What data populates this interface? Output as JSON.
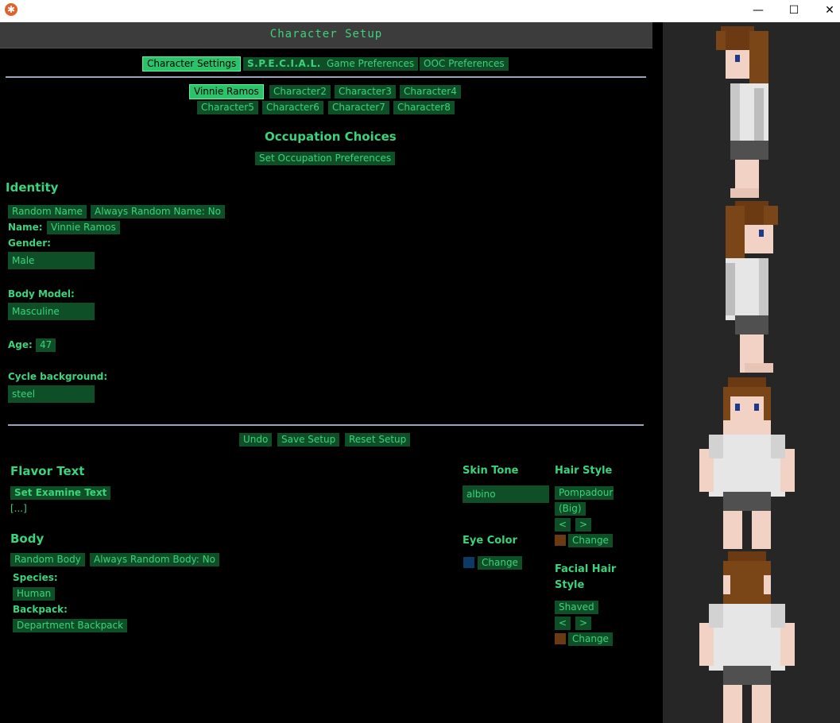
{
  "window": {
    "title_icon": "snowflake-icon",
    "controls": {
      "minimize": "—",
      "maximize": "☐",
      "close": "✕"
    }
  },
  "header": {
    "title": "Character Setup"
  },
  "main_tabs": [
    "Character Settings",
    "S.P.E.C.I.A.L.",
    "Game Preferences",
    "OOC Preferences"
  ],
  "character_slots": [
    "Vinnie Ramos",
    "Character2",
    "Character3",
    "Character4",
    "Character5",
    "Character6",
    "Character7",
    "Character8"
  ],
  "occupation": {
    "title": "Occupation Choices",
    "button": "Set Occupation Preferences"
  },
  "identity": {
    "title": "Identity",
    "random_name": "Random Name",
    "always_random_name": "Always Random Name: No",
    "name_label": "Name:",
    "name_value": "Vinnie Ramos",
    "gender_label": "Gender:",
    "gender_value": "Male",
    "body_model_label": "Body Model:",
    "body_model_value": "Masculine",
    "age_label": "Age:",
    "age_value": "47",
    "cycle_label": "Cycle background:",
    "cycle_value": "steel"
  },
  "actions": {
    "undo": "Undo",
    "save": "Save Setup",
    "reset": "Reset Setup"
  },
  "flavor": {
    "title": "Flavor Text",
    "button": "Set Examine Text",
    "preview": "[...]"
  },
  "body": {
    "title": "Body",
    "random_body": "Random Body",
    "always_random_body": "Always Random Body: No",
    "species_label": "Species:",
    "species_value": "Human",
    "backpack_label": "Backpack:",
    "backpack_value": "Department Backpack"
  },
  "skin_tone": {
    "title": "Skin Tone",
    "value": "albino"
  },
  "eye_color": {
    "title": "Eye Color",
    "change": "Change",
    "color": "#0b3a66"
  },
  "hair_style": {
    "title": "Hair Style",
    "value_line1": "Pompadour",
    "value_line2": "(Big)",
    "prev": "<",
    "next": ">",
    "change": "Change",
    "color": "#6b3a12"
  },
  "facial_hair": {
    "title_line1": "Facial Hair",
    "title_line2": "Style",
    "value": "Shaved",
    "prev": "<",
    "next": ">",
    "change": "Change",
    "color": "#6b3a12"
  },
  "colors": {
    "accent": "#3bd37b",
    "button_bg": "#0f4f28",
    "selected_bg": "#2bc36a",
    "panel": "#262626"
  }
}
